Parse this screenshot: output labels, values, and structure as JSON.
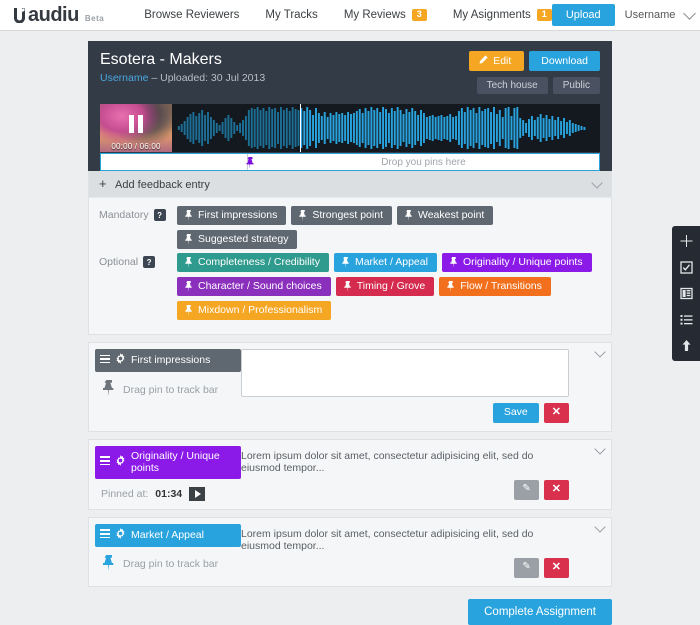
{
  "navbar": {
    "brand": "audiu",
    "brand_beta": "Beta",
    "links": [
      {
        "label": "Browse Reviewers",
        "badge": null
      },
      {
        "label": "My Tracks",
        "badge": null
      },
      {
        "label": "My Reviews",
        "badge": "3"
      },
      {
        "label": "My Asignments",
        "badge": "1"
      }
    ],
    "upload_label": "Upload",
    "username": "Username"
  },
  "track": {
    "title": "Esotera - Makers",
    "uploader": "Username",
    "uploaded_text": "– Uploaded: 30 Jul 2013",
    "edit_label": "Edit",
    "download_label": "Download",
    "genre_tag": "Tech house",
    "visibility_tag": "Public",
    "time_display": "00:00 / 06:00",
    "pinbar_placeholder": "Drop you pins here"
  },
  "feedback": {
    "add_entry_label": "Add feedback entry",
    "add_plus": "+",
    "mandatory_label": "Mandatory",
    "optional_label": "Optional",
    "help_glyph": "?",
    "mandatory_tags": [
      {
        "label": "First impressions",
        "color": "#5f6771"
      },
      {
        "label": "Strongest point",
        "color": "#5f6771"
      },
      {
        "label": "Weakest point",
        "color": "#5f6771"
      },
      {
        "label": "Suggested strategy",
        "color": "#5f6771"
      }
    ],
    "optional_tags": [
      {
        "label": "Completeness / Credibility",
        "color": "#2f9a8e"
      },
      {
        "label": "Market / Appeal",
        "color": "#29a3dd"
      },
      {
        "label": "Originality / Unique points",
        "color": "#8b19e8"
      },
      {
        "label": "Character / Sound choices",
        "color": "#8b2fbd"
      },
      {
        "label": "Timing / Grove",
        "color": "#d42b4e"
      },
      {
        "label": "Flow / Transitions",
        "color": "#f2701d"
      },
      {
        "label": "Mixdown / Professionalism",
        "color": "#f5a623"
      }
    ]
  },
  "cards": [
    {
      "title": "First impressions",
      "color": "#5f6771",
      "pin_hint": "Drag pin to track bar",
      "pin_color": "#5f6771",
      "has_textarea": true,
      "text": "",
      "pinned_label": null,
      "pinned_time": null,
      "save_label": "Save",
      "close_label": "✕",
      "has_pin_icon": false
    },
    {
      "title": "Originality / Unique points",
      "color": "#8b19e8",
      "pin_hint": null,
      "pin_color": "#8b19e8",
      "has_textarea": false,
      "text": "Lorem ipsum dolor sit amet, consectetur adipisicing elit, sed do eiusmod tempor...",
      "pinned_label": "Pinned at:",
      "pinned_time": "01:34",
      "edit_label": "✎",
      "close_label": "✕",
      "has_pin_icon": false
    },
    {
      "title": "Market / Appeal",
      "color": "#29a3dd",
      "pin_hint": "Drag pin to track bar",
      "pin_color": "#29a3dd",
      "has_textarea": false,
      "text": "Lorem ipsum dolor sit amet, consectetur adipisicing elit, sed do eiusmod tempor...",
      "pinned_label": null,
      "pinned_time": null,
      "edit_label": "✎",
      "close_label": "✕",
      "has_pin_icon": false
    }
  ],
  "footer": {
    "complete_label": "Complete Assignment"
  },
  "rail": {
    "items": [
      "plus-icon",
      "checkbox-icon",
      "panel-icon",
      "list-icon",
      "arrow-up-icon"
    ]
  },
  "colors": {
    "accent_blue": "#29a3dd",
    "accent_orange": "#f5a623",
    "danger_red": "#d9304e",
    "panel_dark": "#333b47",
    "waveform_bright": "#29a3dd",
    "waveform_dim": "#1d6f96",
    "pin_purple": "#7b10e0"
  }
}
